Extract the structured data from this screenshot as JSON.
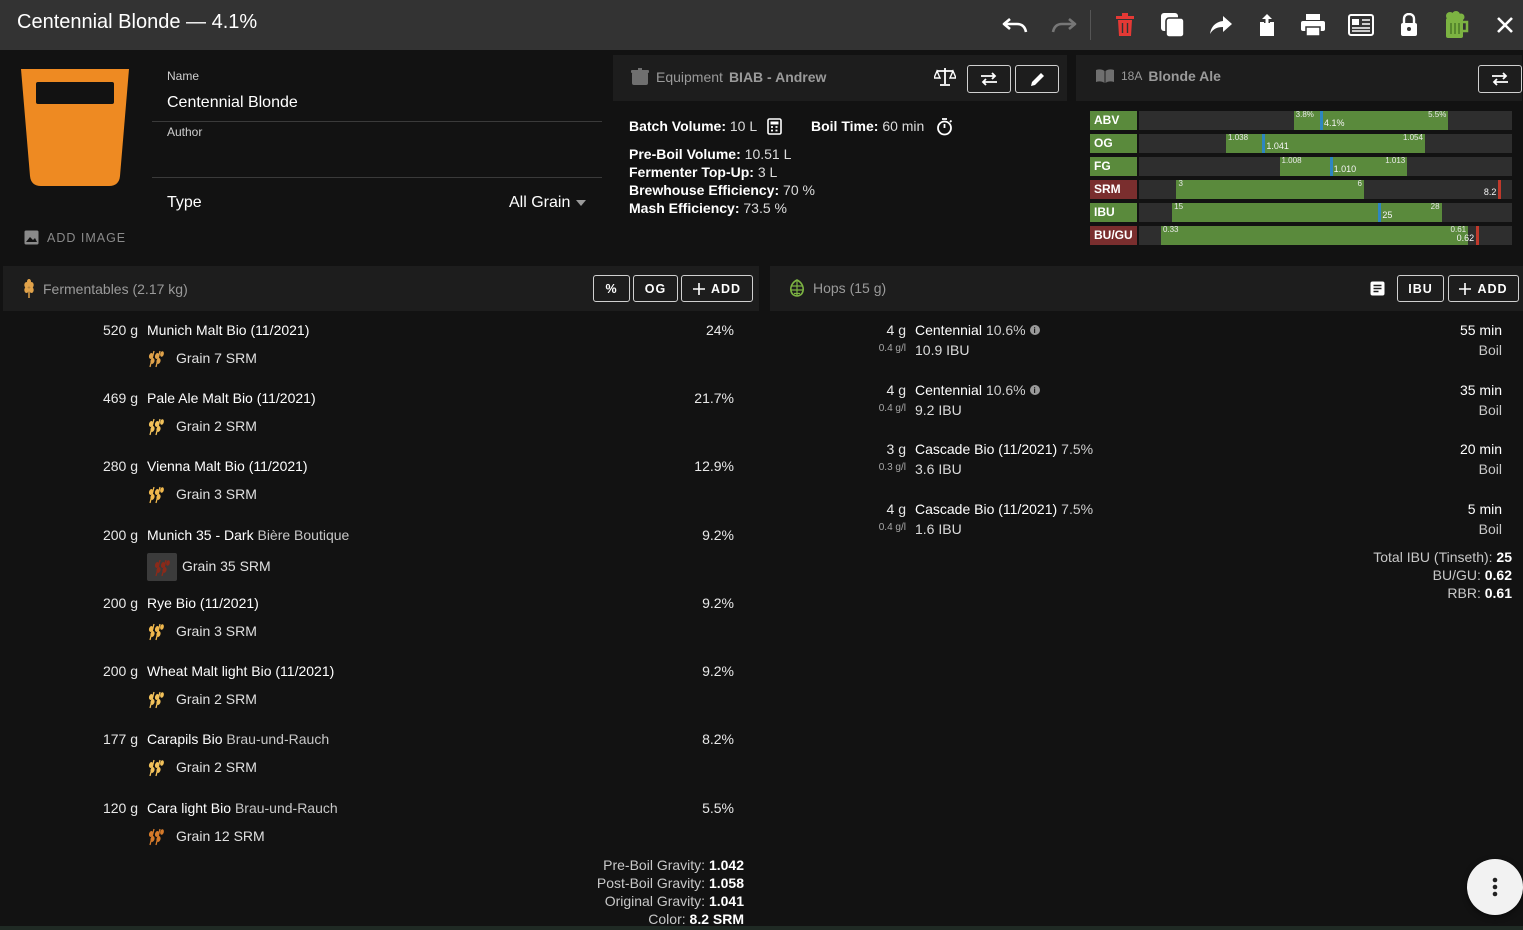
{
  "topbar": {
    "title": "Centennial Blonde — 4.1%",
    "actions": [
      "undo-icon",
      "redo-icon",
      "delete-icon",
      "copy-icon",
      "share-icon",
      "export-icon",
      "print-icon",
      "newspaper-icon",
      "lock-icon",
      "beer-mug-icon",
      "close-icon"
    ]
  },
  "recipe": {
    "name_label": "Name",
    "name_value": "Centennial Blonde",
    "author_label": "Author",
    "author_value": "",
    "type_label": "Type",
    "type_value": "All Grain",
    "add_image_label": "ADD IMAGE",
    "glass_color": "#ee8a22"
  },
  "equipment": {
    "prefix": "Equipment",
    "name": "BIAB - Andrew",
    "batch_volume_label": "Batch Volume:",
    "batch_volume_value": "10 L",
    "boil_time_label": "Boil Time:",
    "boil_time_value": "60 min",
    "pre_boil_label": "Pre-Boil Volume:",
    "pre_boil_value": "10.51 L",
    "topup_label": "Fermenter Top-Up:",
    "topup_value": "3 L",
    "brewhouse_label": "Brewhouse Efficiency:",
    "brewhouse_value": "70 %",
    "mash_label": "Mash Efficiency:",
    "mash_value": "73.5 %"
  },
  "style": {
    "code": "18A",
    "name": "Blonde Ale",
    "rows": [
      {
        "label": "ABV",
        "min": "3.8%",
        "max": "5.5%",
        "value": "4.1%",
        "label_bg": "#5a8a3c",
        "min_num": 3.8,
        "max_num": 5.5,
        "value_num": 4.1,
        "scale": [
          2.1,
          6.2
        ]
      },
      {
        "label": "OG",
        "min": "1.038",
        "max": "1.054",
        "value": "1.041",
        "label_bg": "#5a8a3c",
        "min_num": 1.038,
        "max_num": 1.054,
        "value_num": 1.041,
        "scale": [
          1.031,
          1.061
        ]
      },
      {
        "label": "FG",
        "min": "1.008",
        "max": "1.013",
        "value": "1.010",
        "label_bg": "#5a8a3c",
        "min_num": 1.008,
        "max_num": 1.013,
        "value_num": 1.01,
        "scale": [
          1.0025,
          1.0171
        ]
      },
      {
        "label": "SRM",
        "min": "3",
        "max": "6",
        "value": "8.2",
        "label_bg": "#7a2e2e",
        "min_num": 3,
        "max_num": 6,
        "value_num": 8.2,
        "scale": [
          2.4,
          8.37
        ]
      },
      {
        "label": "IBU",
        "min": "15",
        "max": "28",
        "value": "25",
        "label_bg": "#5a8a3c",
        "min_num": 15,
        "max_num": 28,
        "value_num": 25,
        "scale": [
          13.4,
          31.4
        ]
      },
      {
        "label": "BU/GU",
        "min": "0.33",
        "max": "0.61",
        "value": "0.62",
        "label_bg": "#7a2e2e",
        "min_num": 0.33,
        "max_num": 0.61,
        "value_num": 0.62,
        "scale": [
          0.31,
          0.65
        ]
      }
    ]
  },
  "fermentables": {
    "title": "Fermentables (2.17 kg)",
    "buttons": {
      "pct": "%",
      "og": "OG",
      "add": "ADD"
    },
    "items": [
      {
        "amount": "520 g",
        "name": "Munich Malt Bio (11/2021)",
        "supplier": "",
        "type": "Grain",
        "color": "7 SRM",
        "pct": "24%",
        "icon_color": "#e0a24a"
      },
      {
        "amount": "469 g",
        "name": "Pale Ale Malt Bio (11/2021)",
        "supplier": "",
        "type": "Grain",
        "color": "2 SRM",
        "pct": "21.7%",
        "icon_color": "#f2c15a"
      },
      {
        "amount": "280 g",
        "name": "Vienna Malt Bio (11/2021)",
        "supplier": "",
        "type": "Grain",
        "color": "3 SRM",
        "pct": "12.9%",
        "icon_color": "#f0b84d"
      },
      {
        "amount": "200 g",
        "name": "Munich 35 - Dark",
        "supplier": "Bière Boutique",
        "type": "Grain",
        "color": "35 SRM",
        "pct": "9.2%",
        "icon_color": "#8a2a1a"
      },
      {
        "amount": "200 g",
        "name": "Rye Bio (11/2021)",
        "supplier": "",
        "type": "Grain",
        "color": "3 SRM",
        "pct": "9.2%",
        "icon_color": "#f0b84d"
      },
      {
        "amount": "200 g",
        "name": "Wheat Malt light Bio (11/2021)",
        "supplier": "",
        "type": "Grain",
        "color": "2 SRM",
        "pct": "9.2%",
        "icon_color": "#f2c15a"
      },
      {
        "amount": "177 g",
        "name": "Carapils Bio",
        "supplier": "Brau-und-Rauch",
        "type": "Grain",
        "color": "2 SRM",
        "pct": "8.2%",
        "icon_color": "#f2c15a"
      },
      {
        "amount": "120 g",
        "name": "Cara light Bio",
        "supplier": "Brau-und-Rauch",
        "type": "Grain",
        "color": "12 SRM",
        "pct": "5.5%",
        "icon_color": "#d67a2a"
      }
    ],
    "summary": {
      "pre_boil_label": "Pre-Boil Gravity:",
      "pre_boil_value": "1.042",
      "post_boil_label": "Post-Boil Gravity:",
      "post_boil_value": "1.058",
      "og_label": "Original Gravity:",
      "og_value": "1.041",
      "color_label": "Color:",
      "color_value": "8.2 SRM"
    }
  },
  "hops": {
    "title": "Hops (15 g)",
    "buttons": {
      "ibu": "IBU",
      "add": "ADD"
    },
    "items": [
      {
        "amount": "4 g",
        "rate": "0.4 g/l",
        "name": "Centennial",
        "alpha": "10.6%",
        "info": true,
        "ibu": "10.9 IBU",
        "time": "55 min",
        "use": "Boil"
      },
      {
        "amount": "4 g",
        "rate": "0.4 g/l",
        "name": "Centennial",
        "alpha": "10.6%",
        "info": true,
        "ibu": "9.2 IBU",
        "time": "35 min",
        "use": "Boil"
      },
      {
        "amount": "3 g",
        "rate": "0.3 g/l",
        "name": "Cascade Bio (11/2021)",
        "alpha": "7.5%",
        "info": false,
        "ibu": "3.6 IBU",
        "time": "20 min",
        "use": "Boil"
      },
      {
        "amount": "4 g",
        "rate": "0.4 g/l",
        "name": "Cascade Bio (11/2021)",
        "alpha": "7.5%",
        "info": false,
        "ibu": "1.6 IBU",
        "time": "5 min",
        "use": "Boil"
      }
    ],
    "summary": {
      "total_label": "Total IBU (Tinseth):",
      "total_value": "25",
      "bugu_label": "BU/GU:",
      "bugu_value": "0.62",
      "rbr_label": "RBR:",
      "rbr_value": "0.61"
    }
  }
}
